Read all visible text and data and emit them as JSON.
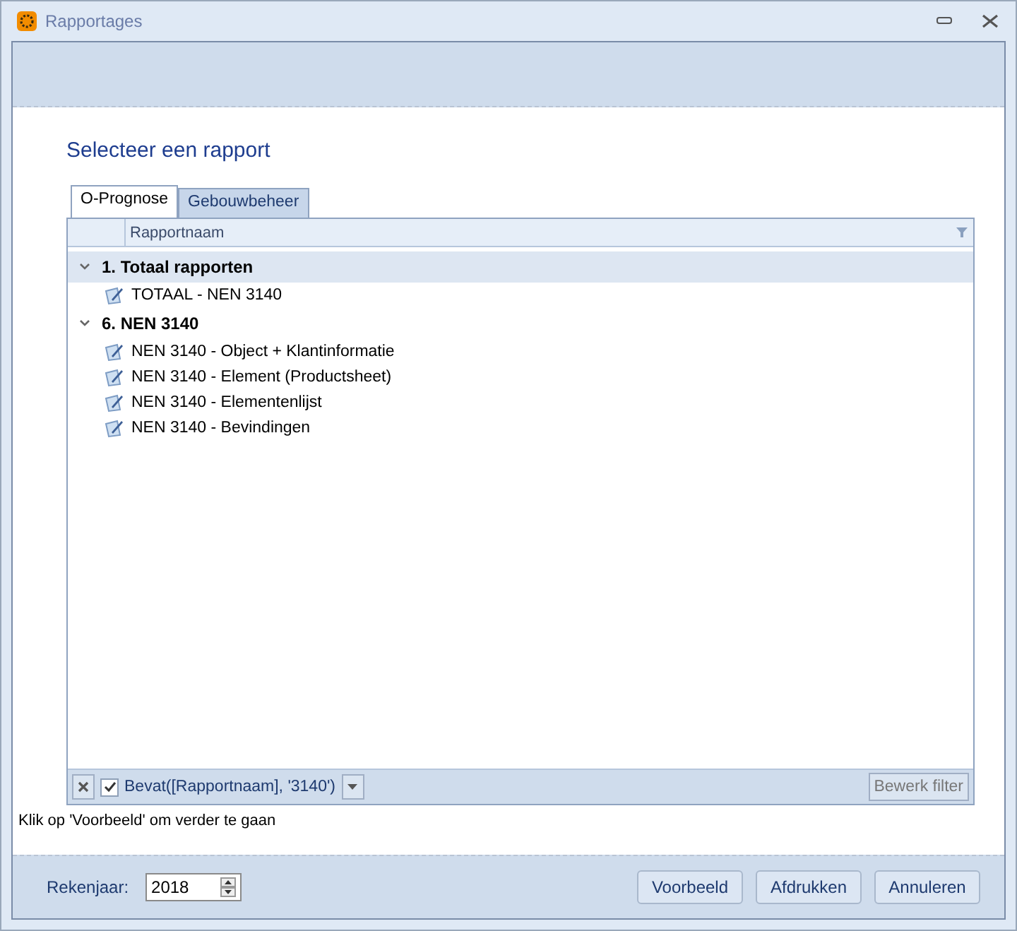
{
  "window": {
    "title": "Rapportages"
  },
  "heading": "Selecteer een rapport",
  "tabs": [
    {
      "label": "O-Prognose",
      "selected": true
    },
    {
      "label": "Gebouwbeheer",
      "selected": false
    }
  ],
  "grid": {
    "columns": [
      "Rapportnaam"
    ],
    "groups": [
      {
        "label": "1. Totaal rapporten",
        "expanded": true,
        "selected": true,
        "children": [
          {
            "label": "TOTAAL - NEN 3140"
          }
        ]
      },
      {
        "label": "6. NEN 3140",
        "expanded": true,
        "selected": false,
        "children": [
          {
            "label": "NEN 3140 - Object + Klantinformatie"
          },
          {
            "label": "NEN 3140 - Element (Productsheet)"
          },
          {
            "label": "NEN 3140 - Elementenlijst"
          },
          {
            "label": "NEN 3140 - Bevindingen"
          }
        ]
      }
    ],
    "filter": {
      "checked": true,
      "expression": "Bevat([Rapportnaam], '3140')",
      "edit_button": "Bewerk filter"
    }
  },
  "hint": "Klik op 'Voorbeeld' om verder te gaan",
  "footer": {
    "year_label": "Rekenjaar:",
    "year_value": "2018",
    "buttons": [
      "Voorbeeld",
      "Afdrukken",
      "Annuleren"
    ]
  }
}
